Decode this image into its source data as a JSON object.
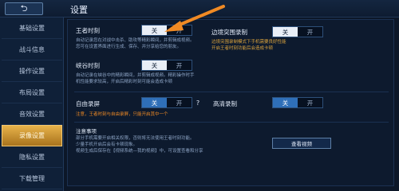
{
  "header": {
    "back_icon": "back-arrow-icon",
    "title": "设置"
  },
  "sidebar": {
    "items": [
      {
        "label": "基础设置"
      },
      {
        "label": "战斗信息"
      },
      {
        "label": "操作设置"
      },
      {
        "label": "布局设置"
      },
      {
        "label": "音效设置"
      },
      {
        "label": "录像设置",
        "active": true
      },
      {
        "label": "隐私设置"
      },
      {
        "label": "下载管理"
      }
    ]
  },
  "settings": {
    "king_moment": {
      "label": "王者时刻",
      "desc1": "自动记录您在对战中击杀、助攻等精彩瞬间，并剪辑成视频。",
      "desc2": "您可在设置界面进行生成、保存、并分享给您的朋友。",
      "off": "关",
      "on": "开",
      "selected": "关"
    },
    "edge_recording": {
      "label": "边境突围录制",
      "desc1": "边境突围录制模式下手机需要良好性能",
      "desc2": "开启王者时刻功能后会造成卡顿",
      "off": "关",
      "on": "开",
      "selected": "关"
    },
    "canyon_moment": {
      "label": "峡谷时刻",
      "desc1": "自动记录在峡谷中的精彩瞬间，并剪辑成视频。精彩操作时手",
      "desc2": "机性能要求较高，开启后精彩时刻可能会造成卡顿",
      "off": "关",
      "on": "开",
      "selected": "关"
    },
    "free_recording": {
      "label": "自由录屏",
      "warn": "注意，王者时刻与自由录屏，只能开启其中一个",
      "off": "关",
      "on": "开",
      "selected": "关",
      "help": "?"
    },
    "hd_recording": {
      "label": "高清录制",
      "off": "关",
      "on": "开",
      "selected": "关"
    }
  },
  "notice": {
    "title": "注意事项",
    "lines": [
      "部分手机需要开启相关权限，否则将无法使用王者时刻功能。",
      "少量手机开启后会有卡顿现象。",
      "视频生成后保存在【视频系统—我的视频】中，可设置查看和分享"
    ],
    "view_button": "查看视频"
  },
  "colors": {
    "accent_orange": "#f08a24",
    "active_tab": "#d9a23c",
    "toggle_blue": "#2f6fb8"
  }
}
